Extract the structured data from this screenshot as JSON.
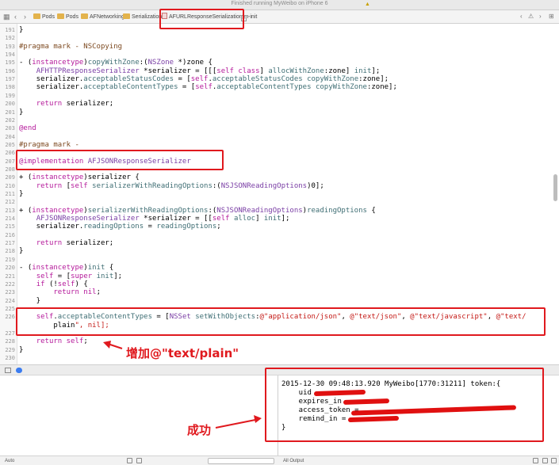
{
  "window": {
    "title": "Finished running MyWeibo on iPhone 6"
  },
  "jumpbar": {
    "crumbs": [
      "Pods",
      "Pods",
      "AFNetworking",
      "Serialization",
      "AFURLResponseSerialization.m",
      "-init"
    ]
  },
  "editor": {
    "lines": [
      {
        "n": "191",
        "t": "}"
      },
      {
        "n": "192",
        "t": ""
      },
      {
        "n": "193",
        "t": "#pragma mark - NSCopying"
      },
      {
        "n": "194",
        "t": ""
      },
      {
        "n": "195",
        "t": "- (instancetype)copyWithZone:(NSZone *)zone {"
      },
      {
        "n": "196",
        "t": "    AFHTTPResponseSerializer *serializer = [[[self class] allocWithZone:zone] init];"
      },
      {
        "n": "197",
        "t": "    serializer.acceptableStatusCodes = [self.acceptableStatusCodes copyWithZone:zone];"
      },
      {
        "n": "198",
        "t": "    serializer.acceptableContentTypes = [self.acceptableContentTypes copyWithZone:zone];"
      },
      {
        "n": "199",
        "t": ""
      },
      {
        "n": "200",
        "t": "    return serializer;"
      },
      {
        "n": "201",
        "t": "}"
      },
      {
        "n": "202",
        "t": ""
      },
      {
        "n": "203",
        "t": "@end"
      },
      {
        "n": "204",
        "t": ""
      },
      {
        "n": "205",
        "t": "#pragma mark -"
      },
      {
        "n": "206",
        "t": ""
      },
      {
        "n": "207",
        "t": "@implementation AFJSONResponseSerializer"
      },
      {
        "n": "208",
        "t": ""
      },
      {
        "n": "209",
        "t": "+ (instancetype)serializer {"
      },
      {
        "n": "210",
        "t": "    return [self serializerWithReadingOptions:(NSJSONReadingOptions)0];"
      },
      {
        "n": "211",
        "t": "}"
      },
      {
        "n": "212",
        "t": ""
      },
      {
        "n": "213",
        "t": "+ (instancetype)serializerWithReadingOptions:(NSJSONReadingOptions)readingOptions {"
      },
      {
        "n": "214",
        "t": "    AFJSONResponseSerializer *serializer = [[self alloc] init];"
      },
      {
        "n": "215",
        "t": "    serializer.readingOptions = readingOptions;"
      },
      {
        "n": "216",
        "t": ""
      },
      {
        "n": "217",
        "t": "    return serializer;"
      },
      {
        "n": "218",
        "t": "}"
      },
      {
        "n": "219",
        "t": ""
      },
      {
        "n": "220",
        "t": "- (instancetype)init {"
      },
      {
        "n": "221",
        "t": "    self = [super init];"
      },
      {
        "n": "222",
        "t": "    if (!self) {"
      },
      {
        "n": "223",
        "t": "        return nil;"
      },
      {
        "n": "224",
        "t": "    }"
      },
      {
        "n": "225",
        "t": ""
      },
      {
        "n": "226",
        "t": "    self.acceptableContentTypes = [NSSet setWithObjects:@\"application/json\", @\"text/json\", @\"text/javascript\", @\"text/"
      },
      {
        "n": "",
        "t": "        plain\", nil];"
      },
      {
        "n": "227",
        "t": ""
      },
      {
        "n": "228",
        "t": "    return self;"
      },
      {
        "n": "229",
        "t": "}"
      },
      {
        "n": "230",
        "t": ""
      }
    ]
  },
  "console": {
    "lines": [
      "2015-12-30 09:48:13.920 MyWeibo[1770:31211] token:{",
      "    uid",
      "    expires_in",
      "    access_token =",
      "    remind_in =",
      "}"
    ]
  },
  "statusbar": {
    "left": "Auto",
    "right": "All Output"
  },
  "annotations": {
    "added": "增加@\"text/plain\"",
    "success": "成功"
  },
  "colors": {
    "annotation": "#e0191e",
    "keyword": "#b51a9b",
    "string": "#c41a16"
  }
}
